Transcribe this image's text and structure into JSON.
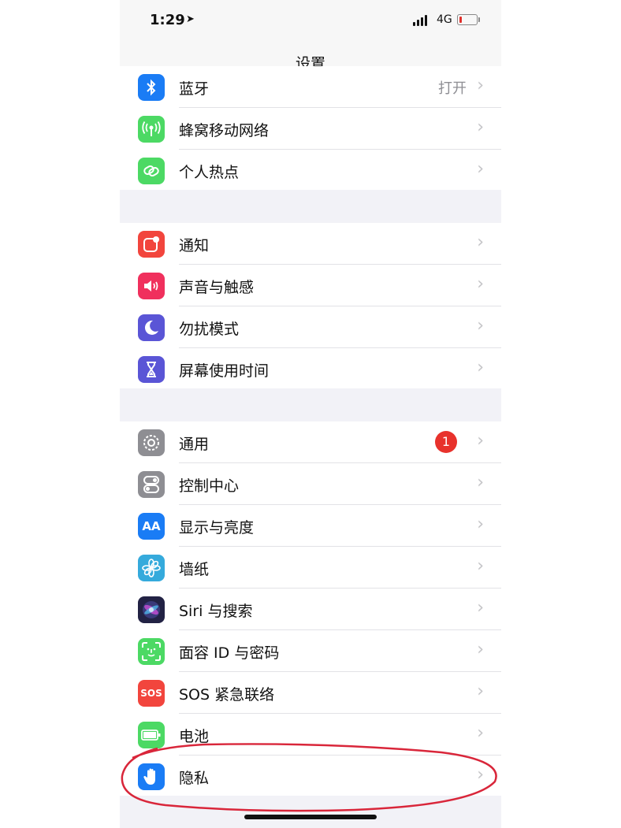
{
  "status_bar": {
    "time": "1:29",
    "location_glyph": "➤",
    "network": "4G"
  },
  "nav": {
    "title": "设置"
  },
  "groups": [
    {
      "rows": [
        {
          "label": "蓝牙",
          "value": "打开",
          "icon": "bluetooth-icon",
          "color": "#1a7cf5"
        },
        {
          "label": "蜂窝移动网络",
          "icon": "cellular-antenna-icon",
          "color": "#4cd964"
        },
        {
          "label": "个人热点",
          "icon": "hotspot-chain-icon",
          "color": "#4cd964"
        }
      ]
    },
    {
      "rows": [
        {
          "label": "通知",
          "icon": "notifications-icon",
          "color": "#f2453d"
        },
        {
          "label": "声音与触感",
          "icon": "speaker-icon",
          "color": "#f0305d"
        },
        {
          "label": "勿扰模式",
          "icon": "moon-icon",
          "color": "#5a55d6"
        },
        {
          "label": "屏幕使用时间",
          "icon": "hourglass-icon",
          "color": "#5a55d6"
        }
      ]
    },
    {
      "rows": [
        {
          "label": "通用",
          "badge": "1",
          "icon": "gear-icon",
          "color": "#8e8e93"
        },
        {
          "label": "控制中心",
          "icon": "toggles-icon",
          "color": "#8e8e93"
        },
        {
          "label": "显示与亮度",
          "icon_text": "AA",
          "icon": "text-size-icon",
          "color": "#1a7cf5"
        },
        {
          "label": "墙纸",
          "icon": "flower-icon",
          "color": "#35aadc"
        },
        {
          "label": "Siri 与搜索",
          "icon": "siri-icon",
          "color": "#222244"
        },
        {
          "label": "面容 ID 与密码",
          "icon": "face-id-icon",
          "color": "#4cd964"
        },
        {
          "label": "SOS 紧急联络",
          "icon_text": "SOS",
          "icon": "sos-icon",
          "color": "#f2453d"
        },
        {
          "label": "电池",
          "icon": "battery-icon",
          "color": "#4cd964"
        },
        {
          "label": "隐私",
          "icon": "hand-icon",
          "color": "#1a7cf5"
        }
      ]
    }
  ],
  "chevron": "›"
}
